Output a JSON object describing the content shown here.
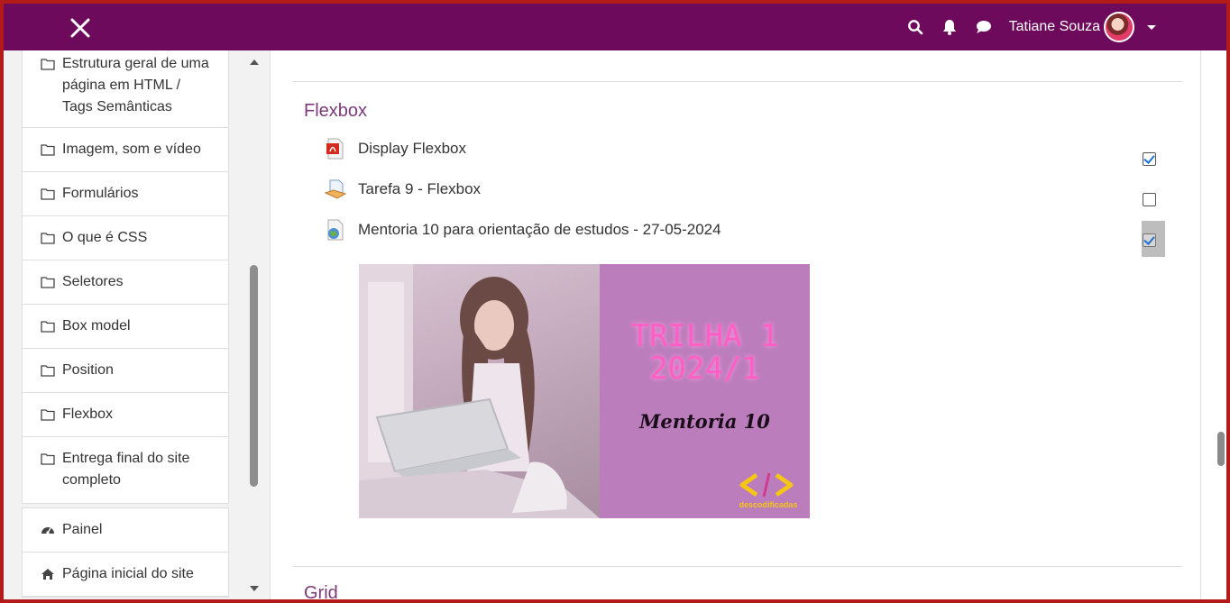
{
  "navbar": {
    "user_name": "Tatiane Souza",
    "bg_color": "#6e0a5c",
    "icons": [
      "close-icon",
      "search-icon",
      "bell-icon",
      "chat-icon",
      "user-menu-caret-icon"
    ]
  },
  "drawer": {
    "sections": [
      {
        "label": "Estrutura geral de uma página em HTML / Tags Semânticas",
        "lines": [
          "Estrutura geral de uma",
          "página em HTML /",
          "Tags Semânticas"
        ]
      },
      {
        "label": "Imagem, som e vídeo",
        "lines": [
          "Imagem, som e vídeo"
        ]
      },
      {
        "label": "Formulários",
        "lines": [
          "Formulários"
        ]
      },
      {
        "label": "O que é CSS",
        "lines": [
          "O que é CSS"
        ]
      },
      {
        "label": "Seletores",
        "lines": [
          "Seletores"
        ]
      },
      {
        "label": "Box model",
        "lines": [
          "Box model"
        ]
      },
      {
        "label": "Position",
        "lines": [
          "Position"
        ]
      },
      {
        "label": "Flexbox",
        "lines": [
          "Flexbox"
        ]
      },
      {
        "label": "Entrega final do site completo",
        "lines": [
          "Entrega final do site",
          "completo"
        ]
      }
    ],
    "nav": [
      {
        "label": "Painel",
        "icon": "dashboard-icon"
      },
      {
        "label": "Página inicial do site",
        "icon": "home-icon"
      }
    ]
  },
  "main": {
    "section_title": "Flexbox",
    "activities": [
      {
        "label": "Display Flexbox",
        "icon": "pdf-icon",
        "completed": true
      },
      {
        "label": "Tarefa 9 - Flexbox",
        "icon": "assignment-icon",
        "completed": false
      },
      {
        "label": "Mentoria 10 para orientação de estudos - 27-05-2024",
        "icon": "url-globe-icon",
        "completed": true
      }
    ],
    "banner": {
      "line1": "TRILHA 1",
      "line2": "2024/1",
      "subtitle": "Mentoria 10",
      "logo_text": "descodificadas"
    },
    "next_section_title": "Grid"
  }
}
